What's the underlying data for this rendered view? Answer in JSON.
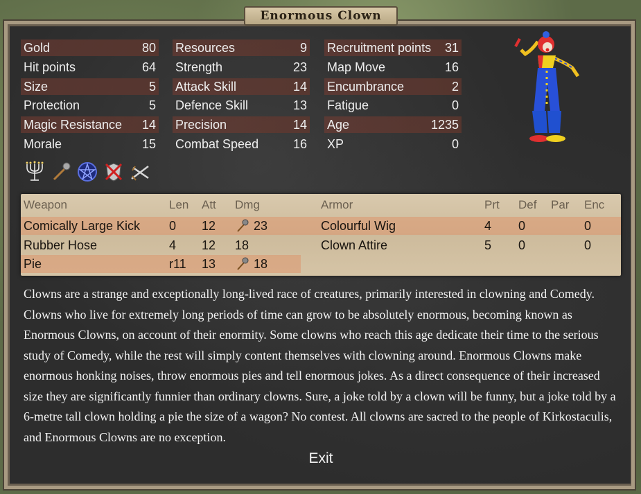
{
  "title": "Enormous Clown",
  "stats_col1": [
    {
      "label": "Gold",
      "value": "80"
    },
    {
      "label": "Hit points",
      "value": "64"
    },
    {
      "label": "Size",
      "value": "5"
    },
    {
      "label": "Protection",
      "value": "5"
    },
    {
      "label": "Magic Resistance",
      "value": "14"
    },
    {
      "label": "Morale",
      "value": "15"
    }
  ],
  "stats_col2": [
    {
      "label": "Resources",
      "value": "9"
    },
    {
      "label": "Strength",
      "value": "23"
    },
    {
      "label": "Attack Skill",
      "value": "14"
    },
    {
      "label": "Defence Skill",
      "value": "13"
    },
    {
      "label": "Precision",
      "value": "14"
    },
    {
      "label": "Combat Speed",
      "value": "16"
    }
  ],
  "stats_col3": [
    {
      "label": "Recruitment points",
      "value": "31"
    },
    {
      "label": "Map Move",
      "value": "16"
    },
    {
      "label": "Encumbrance",
      "value": "2"
    },
    {
      "label": "Fatigue",
      "value": "0"
    },
    {
      "label": "Age",
      "value": "1235"
    },
    {
      "label": "XP",
      "value": "0"
    }
  ],
  "ability_icons": [
    "candelabra-icon",
    "mace-icon",
    "pentagram-icon",
    "crossed-shield-icon",
    "crossed-swords-icon"
  ],
  "weapons_header": {
    "name": "Weapon",
    "len": "Len",
    "att": "Att",
    "dmg": "Dmg"
  },
  "weapons": [
    {
      "name": "Comically Large Kick",
      "len": "0",
      "att": "12",
      "dmg": "23",
      "blunt": true
    },
    {
      "name": "Rubber Hose",
      "len": "4",
      "att": "12",
      "dmg": "18",
      "blunt": false
    },
    {
      "name": "Pie",
      "len": "r11",
      "att": "13",
      "dmg": "18",
      "blunt": true
    }
  ],
  "armor_header": {
    "name": "Armor",
    "prt": "Prt",
    "def": "Def",
    "par": "Par",
    "enc": "Enc"
  },
  "armor": [
    {
      "name": "Colourful Wig",
      "prt": "4",
      "def": "0",
      "par": "",
      "enc": "0"
    },
    {
      "name": "Clown Attire",
      "prt": "5",
      "def": "0",
      "par": "",
      "enc": "0"
    }
  ],
  "description": "Clowns are a strange and exceptionally long-lived race of creatures, primarily interested in clowning and Comedy. Clowns who live for extremely long periods of time can grow to be absolutely enormous, becoming known as Enormous Clowns, on account of their enormity. Some clowns who reach this age dedicate their time to the serious study of Comedy, while the rest will simply content themselves with clowning around. Enormous Clowns make enormous honking noises, throw enormous pies and tell enormous jokes. As a direct consequence of their increased size they are significantly funnier than ordinary clowns. Sure, a joke told by a clown will be funny, but a joke told by a 6-metre tall clown holding a pie the size of a wagon? No contest. All clowns are sacred to the people of Kirkostaculis, and Enormous Clowns are no exception.",
  "exit_label": "Exit"
}
